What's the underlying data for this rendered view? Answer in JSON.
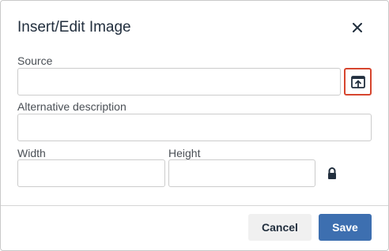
{
  "dialog": {
    "title": "Insert/Edit Image",
    "close_icon": "close-icon"
  },
  "form": {
    "source": {
      "label": "Source",
      "value": "",
      "browse_icon": "upload-icon"
    },
    "alt": {
      "label": "Alternative description",
      "value": ""
    },
    "width": {
      "label": "Width",
      "value": ""
    },
    "height": {
      "label": "Height",
      "value": ""
    },
    "constrain_icon": "lock-icon"
  },
  "footer": {
    "cancel_label": "Cancel",
    "save_label": "Save"
  },
  "colors": {
    "accent": "#3d6fb0",
    "highlight": "#d6452e"
  }
}
